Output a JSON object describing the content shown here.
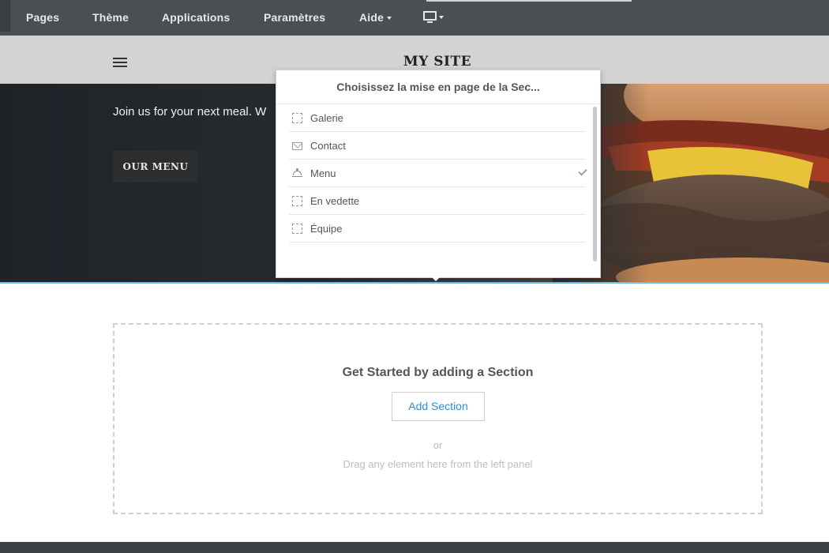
{
  "toolbar": {
    "items": [
      {
        "label": "Pages"
      },
      {
        "label": "Thème"
      },
      {
        "label": "Applications"
      },
      {
        "label": "Paramètres"
      },
      {
        "label": "Aide"
      }
    ],
    "device_icon": "desktop-monitor-icon"
  },
  "site": {
    "title": "MY SITE",
    "menu_icon": "hamburger-menu-icon"
  },
  "hero": {
    "tagline": "Join us for your next meal. W",
    "button_label": "OUR MENU"
  },
  "layout_popup": {
    "title": "Choisissez la mise en page de la Sec...",
    "items": [
      {
        "label": "Galerie",
        "icon": "dashed-square-icon",
        "selected": false
      },
      {
        "label": "Contact",
        "icon": "envelope-icon",
        "selected": false
      },
      {
        "label": "Menu",
        "icon": "cloche-icon",
        "selected": true
      },
      {
        "label": "En vedette",
        "icon": "dashed-square-icon",
        "selected": false
      },
      {
        "label": "Équipe",
        "icon": "dashed-square-icon",
        "selected": false
      }
    ],
    "selected_icon": "checkmark-icon"
  },
  "empty_section": {
    "heading": "Get Started by adding a Section",
    "add_button_label": "Add Section",
    "or_text": "or",
    "hint": "Drag any element here from the left panel"
  },
  "colors": {
    "toolbar_bg": "#4b4f54",
    "header_bg": "#d3d3d3",
    "accent_link": "#2a8fd6",
    "section_border": "#6ec1e4"
  }
}
